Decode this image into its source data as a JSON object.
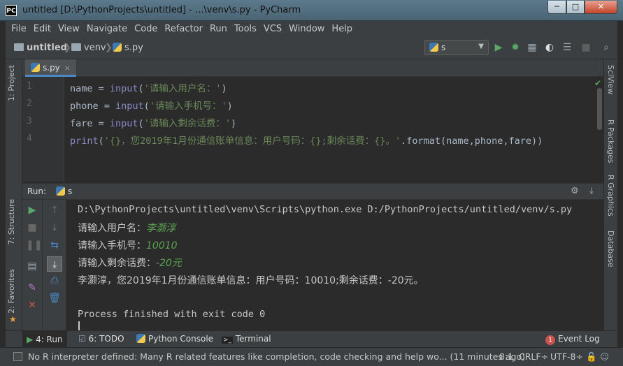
{
  "window": {
    "app_icon_text": "PC",
    "title": "untitled [D:\\PythonProjects\\untitled] - ...\\venv\\s.py - PyCharm",
    "min_label": "─",
    "max_label": "□",
    "close_label": "✕"
  },
  "menu": [
    "File",
    "Edit",
    "View",
    "Navigate",
    "Code",
    "Refactor",
    "Run",
    "Tools",
    "VCS",
    "Window",
    "Help"
  ],
  "breadcrumb": {
    "project": "untitled",
    "folder": "venv",
    "file": "s.py"
  },
  "run_config": {
    "name": "s",
    "caret": "▼"
  },
  "left_tabs": {
    "project": "1: Project",
    "structure": "7: Structure",
    "favorites": "2: Favorites"
  },
  "right_tabs": {
    "sciview": "SciView",
    "r_packages": "R Packages",
    "r_graphics": "R Graphics",
    "database": "Database"
  },
  "editor": {
    "tab": "s.py",
    "tab_close": "×",
    "line_numbers": [
      "1",
      "2",
      "3",
      "4"
    ],
    "lines": [
      {
        "var": "name",
        "op": " = ",
        "fn": "input",
        "open": "(",
        "str": "'请输入用户名：'",
        "close": ")"
      },
      {
        "var": "phone",
        "op": " = ",
        "fn": "input",
        "open": "(",
        "str": "'请输入手机号：'",
        "close": ")"
      },
      {
        "var": "fare",
        "op": " = ",
        "fn": "input",
        "open": "(",
        "str": "'请输入剩余话费：'",
        "close": ")"
      },
      {
        "fn": "print",
        "open": "(",
        "str": "'{}，您2019年1月份通信账单信息：用户号码：{};剩余话费：{}。'",
        "rest": ".format(name,phone,fare))"
      }
    ]
  },
  "run": {
    "label": "Run:",
    "config": "s",
    "console": {
      "command": "D:\\PythonProjects\\untitled\\venv\\Scripts\\python.exe D:/PythonProjects/untitled/venv/s.py",
      "prompt1": "请输入用户名：",
      "input1": "李灏淳",
      "prompt2": "请输入手机号：",
      "input2": "10010",
      "prompt3": "请输入剩余话费：",
      "input3": "-20元",
      "result": "李灏淳，您2019年1月份通信账单信息：用户号码：10010;剩余话费：-20元。",
      "exit": "Process finished with exit code 0"
    }
  },
  "bottom_tabs": {
    "run": "4: Run",
    "todo": "6: TODO",
    "python_console": "Python Console",
    "terminal": "Terminal",
    "event_log": "Event Log",
    "event_count": "1"
  },
  "status": {
    "message": "No R interpreter defined: Many R related features like completion, code checking and help wo... (11 minutes ago)",
    "position": "8:1",
    "line_sep": "CRLF÷",
    "encoding": "UTF-8÷"
  },
  "colors": {
    "accent": "#4a88c7",
    "run_green": "#59a869",
    "stop_red": "#c75450",
    "string": "#6a8759",
    "builtin": "#8888c6"
  }
}
